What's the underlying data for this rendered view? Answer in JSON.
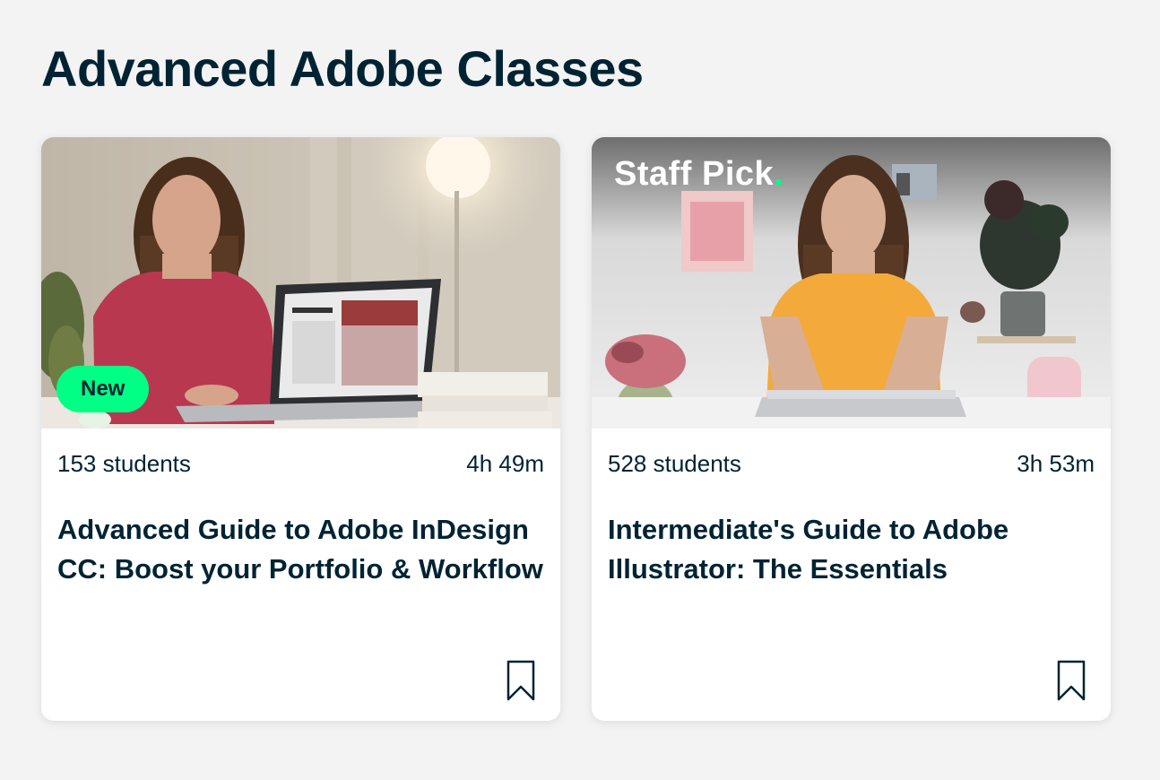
{
  "section": {
    "title": "Advanced Adobe Classes"
  },
  "cards": [
    {
      "badge": "New",
      "students": "153 students",
      "duration": "4h 49m",
      "title": "Advanced Guide to Adobe InDesign CC: Boost your Portfolio & Workflow"
    },
    {
      "badge_brand": "Staff Pick",
      "badge_dot": ".",
      "students": "528 students",
      "duration": "3h 53m",
      "title": "Intermediate's Guide to Adobe Illustrator: The Essentials"
    }
  ],
  "icons": {
    "bookmark": "bookmark-icon"
  },
  "colors": {
    "accent": "#00ff84",
    "text": "#002333",
    "background": "#f3f3f3"
  }
}
